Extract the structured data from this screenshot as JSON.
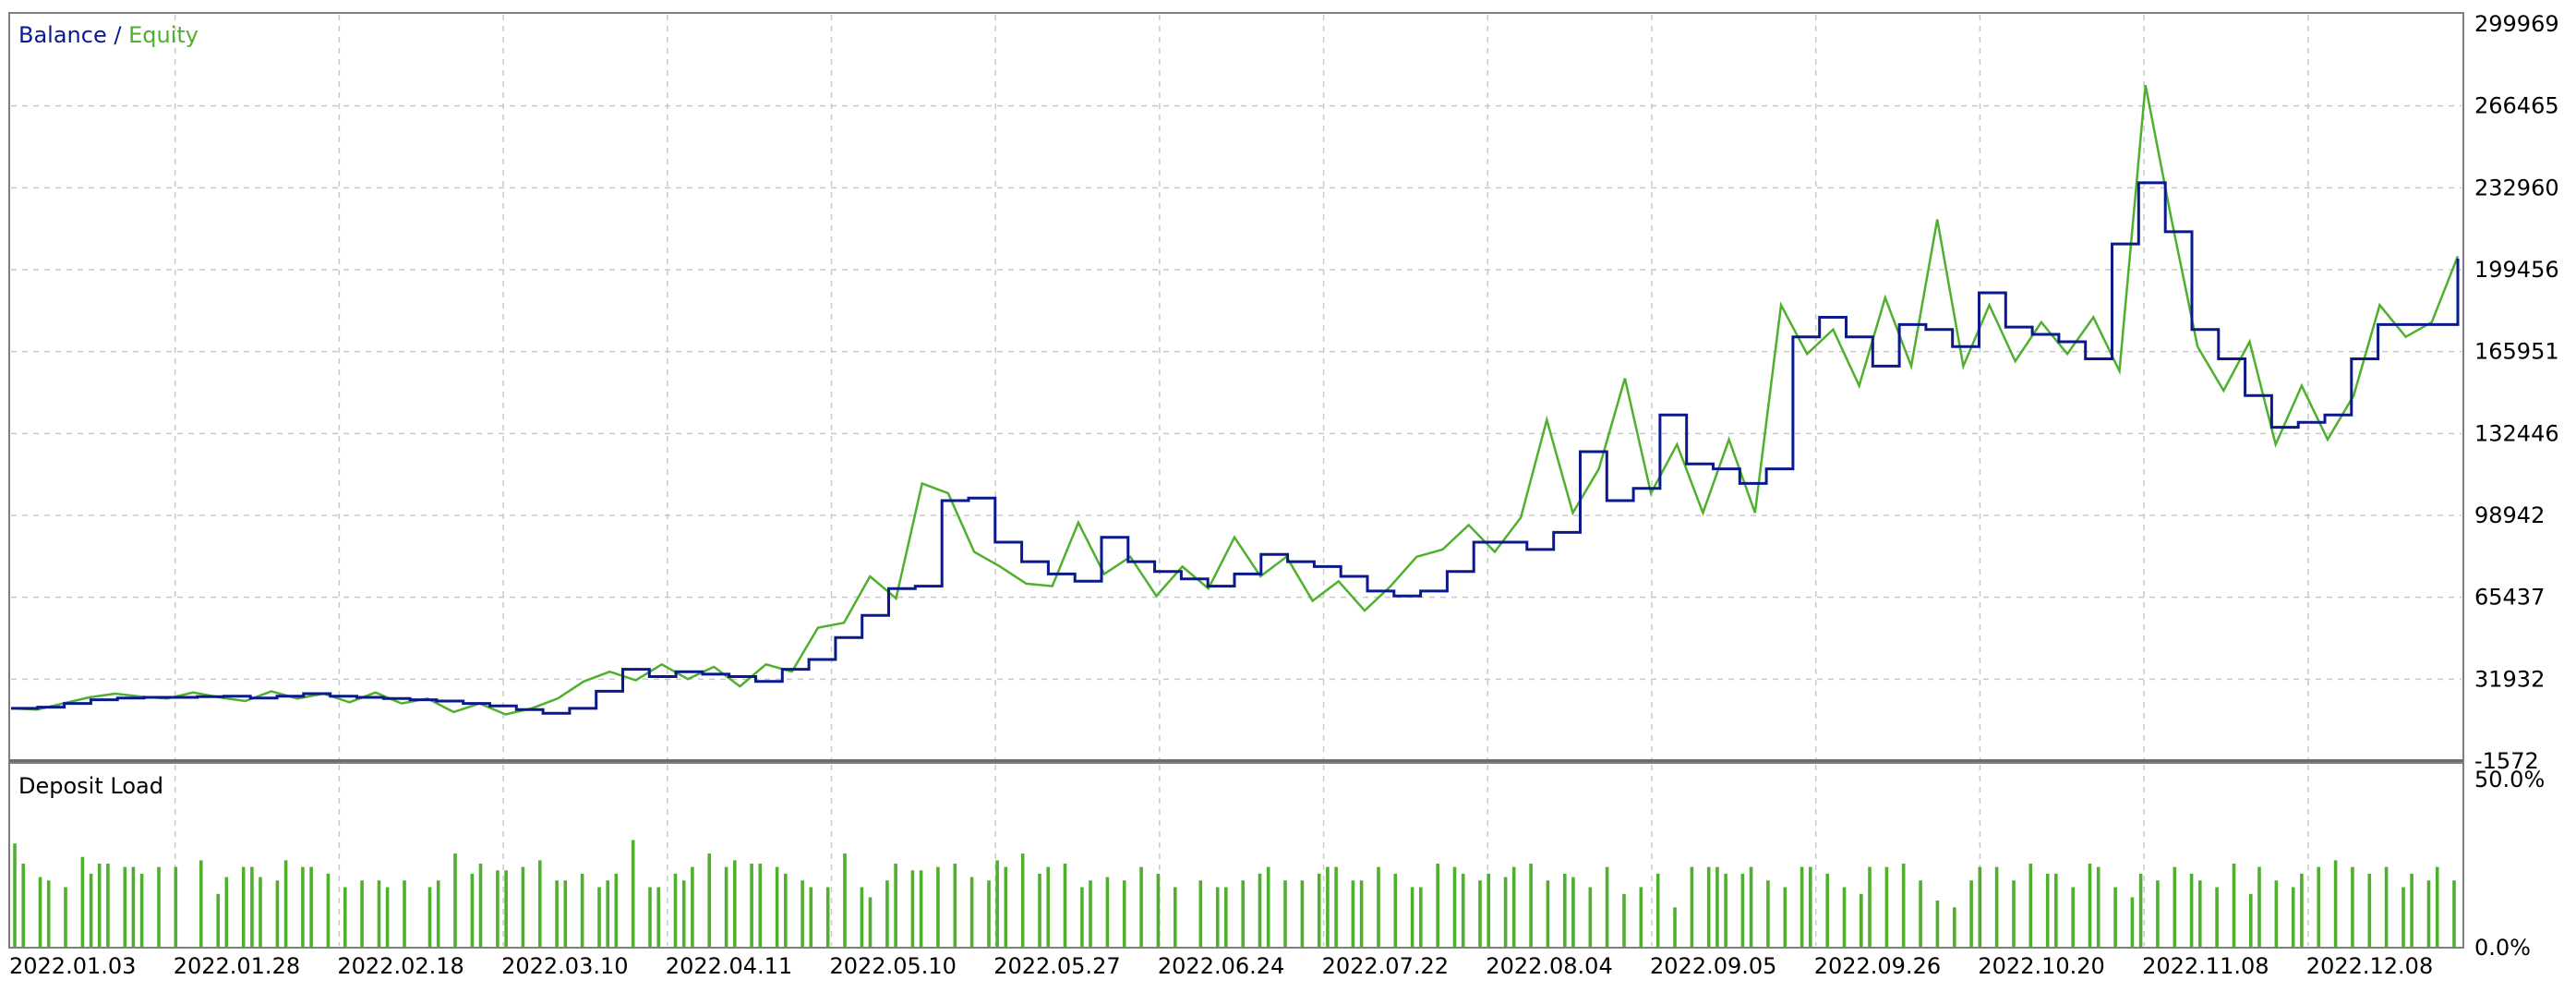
{
  "chart_data": [
    {
      "type": "line",
      "title": "",
      "legend": {
        "position": "top-left",
        "separator": " / ",
        "entries": [
          {
            "name": "Balance",
            "color": "#0a1a8c"
          },
          {
            "name": "Equity",
            "color": "#4fb02e"
          }
        ]
      },
      "ylim": [
        -1572,
        299969
      ],
      "y_ticks": [
        "299969",
        "266465",
        "232960",
        "199456",
        "165951",
        "132446",
        "98942",
        "65437",
        "31932",
        "-1572"
      ],
      "grid": true,
      "series": [
        {
          "name": "Balance",
          "color": "#0a1a8c",
          "step": true,
          "values": [
            20000,
            20500,
            22000,
            23500,
            24200,
            24500,
            24500,
            24800,
            25000,
            24200,
            25000,
            26000,
            25000,
            24500,
            24000,
            23500,
            23000,
            22000,
            21000,
            19500,
            18000,
            20000,
            27000,
            36000,
            33000,
            35000,
            34000,
            33000,
            31000,
            36000,
            40000,
            49000,
            58000,
            69000,
            70000,
            105000,
            106000,
            88000,
            80000,
            75000,
            72000,
            90000,
            80000,
            76000,
            73000,
            70000,
            75000,
            83000,
            80000,
            78000,
            74000,
            68000,
            66000,
            68000,
            76000,
            88000,
            88000,
            85000,
            92000,
            125000,
            105000,
            110000,
            140000,
            120000,
            118000,
            112000,
            118000,
            172000,
            180000,
            172000,
            160000,
            177000,
            175000,
            168000,
            190000,
            176000,
            173000,
            170000,
            163000,
            210000,
            235000,
            215000,
            175000,
            163000,
            148000,
            135000,
            137000,
            140000,
            163000,
            177000,
            177000,
            177000,
            204000
          ]
        },
        {
          "name": "Equity",
          "color": "#4fb02e",
          "values": [
            20000,
            19500,
            22000,
            24500,
            26000,
            24800,
            24000,
            26500,
            24500,
            23000,
            27000,
            24000,
            26000,
            22500,
            26500,
            22000,
            24000,
            18500,
            22000,
            17500,
            20000,
            24000,
            31000,
            35000,
            31500,
            38000,
            32000,
            37000,
            29000,
            38000,
            35000,
            53000,
            55000,
            74000,
            65000,
            112000,
            108000,
            84000,
            78000,
            71000,
            70000,
            96000,
            75000,
            82000,
            66000,
            78000,
            69000,
            90000,
            74000,
            82000,
            64000,
            72000,
            60000,
            70000,
            82000,
            85000,
            95000,
            84000,
            98000,
            138000,
            100000,
            118000,
            155000,
            108000,
            128000,
            100000,
            130000,
            100000,
            185000,
            165000,
            175000,
            152000,
            188000,
            160000,
            220000,
            160000,
            185000,
            162000,
            178000,
            165000,
            180000,
            158000,
            275000,
            220000,
            168000,
            150000,
            170000,
            128000,
            152000,
            130000,
            148000,
            185000,
            172000,
            178000,
            205000
          ]
        }
      ]
    },
    {
      "type": "bar",
      "title": "Deposit Load",
      "ylim": [
        0,
        50
      ],
      "y_ticks": [
        "50.0%",
        "0.0%"
      ],
      "x_ticks": [
        "2022.01.03",
        "2022.01.28",
        "2022.02.18",
        "2022.03.10",
        "2022.04.11",
        "2022.05.10",
        "2022.05.27",
        "2022.06.24",
        "2022.07.22",
        "2022.08.04",
        "2022.09.05",
        "2022.09.26",
        "2022.10.20",
        "2022.11.08",
        "2022.12.08"
      ],
      "series": [
        {
          "name": "Deposit Load",
          "color": "#4fb02e",
          "values": [
            31,
            25,
            0,
            21,
            20,
            0,
            18,
            0,
            27,
            22,
            25,
            25,
            0,
            24,
            24,
            22,
            0,
            24,
            0,
            24,
            0,
            0,
            26,
            0,
            16,
            21,
            0,
            24,
            24,
            21,
            0,
            20,
            26,
            0,
            24,
            24,
            0,
            22,
            0,
            18,
            0,
            20,
            0,
            20,
            18,
            0,
            20,
            0,
            0,
            18,
            20,
            0,
            28,
            0,
            22,
            25,
            0,
            23,
            23,
            0,
            24,
            0,
            26,
            0,
            20,
            20,
            0,
            22,
            0,
            18,
            20,
            22,
            0,
            32,
            0,
            18,
            18,
            0,
            22,
            20,
            24,
            0,
            28,
            0,
            24,
            26,
            0,
            25,
            25,
            0,
            24,
            22,
            0,
            20,
            18,
            0,
            18,
            0,
            28,
            0,
            18,
            15,
            0,
            20,
            25,
            0,
            23,
            23,
            0,
            24,
            0,
            25,
            0,
            21,
            0,
            20,
            26,
            24,
            0,
            28,
            0,
            22,
            24,
            0,
            25,
            0,
            18,
            20,
            0,
            21,
            0,
            20,
            0,
            24,
            0,
            22,
            0,
            18,
            0,
            0,
            20,
            0,
            18,
            18,
            0,
            20,
            0,
            22,
            24,
            0,
            20,
            0,
            20,
            0,
            22,
            24,
            24,
            0,
            20,
            20,
            0,
            24,
            0,
            22,
            0,
            18,
            18,
            0,
            25,
            0,
            24,
            22,
            0,
            20,
            22,
            0,
            21,
            24,
            0,
            25,
            0,
            20,
            0,
            22,
            21,
            0,
            18,
            0,
            24,
            0,
            16,
            0,
            18,
            0,
            22,
            0,
            12,
            0,
            24,
            0,
            24,
            24,
            22,
            0,
            22,
            24,
            0,
            20,
            0,
            18,
            0,
            24,
            24,
            0,
            22,
            0,
            18,
            0,
            16,
            24,
            0,
            24,
            0,
            25,
            0,
            20,
            0,
            14,
            0,
            12,
            0,
            20,
            24,
            0,
            24,
            0,
            20,
            0,
            25,
            0,
            22,
            22,
            0,
            18,
            0,
            25,
            24,
            0,
            18,
            0,
            15,
            22,
            0,
            20,
            0,
            24,
            0,
            22,
            20,
            0,
            18,
            0,
            25,
            0,
            16,
            24,
            0,
            20,
            0,
            18,
            22,
            0,
            24,
            0,
            26,
            0,
            24,
            0,
            22,
            0,
            24,
            0,
            18,
            22,
            0,
            20,
            24,
            0,
            20
          ]
        }
      ]
    }
  ]
}
